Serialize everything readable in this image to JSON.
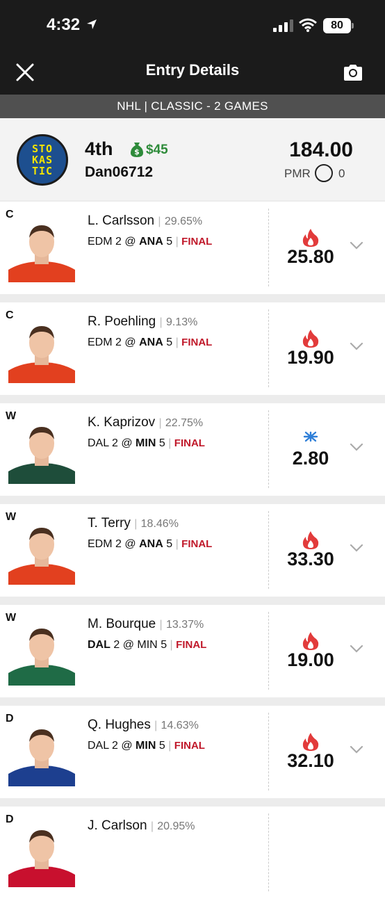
{
  "status_bar": {
    "time": "4:32",
    "battery": "80"
  },
  "header": {
    "title": "Entry Details"
  },
  "contest": {
    "label": "NHL | CLASSIC - 2 GAMES"
  },
  "entry": {
    "logo_lines": [
      "STO",
      "KAS",
      "TIC"
    ],
    "rank": "4th",
    "prize": "$45",
    "username": "Dan06712",
    "score": "184.00",
    "pmr_label": "PMR",
    "pmr_value": "0"
  },
  "players": [
    {
      "pos": "C",
      "name": "L. Carlsson",
      "own": "29.65%",
      "away": "EDM",
      "away_score": "2",
      "at": "@",
      "home": "ANA",
      "home_score": "5",
      "bold_team": "home",
      "status": "FINAL",
      "trend": "fire",
      "fpts": "25.80",
      "jersey": "#e2401f"
    },
    {
      "pos": "C",
      "name": "R. Poehling",
      "own": "9.13%",
      "away": "EDM",
      "away_score": "2",
      "at": "@",
      "home": "ANA",
      "home_score": "5",
      "bold_team": "home",
      "status": "FINAL",
      "trend": "fire",
      "fpts": "19.90",
      "jersey": "#e2401f"
    },
    {
      "pos": "W",
      "name": "K. Kaprizov",
      "own": "22.75%",
      "away": "DAL",
      "away_score": "2",
      "at": "@",
      "home": "MIN",
      "home_score": "5",
      "bold_team": "home",
      "status": "FINAL",
      "trend": "ice",
      "fpts": "2.80",
      "jersey": "#1e4d3a"
    },
    {
      "pos": "W",
      "name": "T. Terry",
      "own": "18.46%",
      "away": "EDM",
      "away_score": "2",
      "at": "@",
      "home": "ANA",
      "home_score": "5",
      "bold_team": "home",
      "status": "FINAL",
      "trend": "fire",
      "fpts": "33.30",
      "jersey": "#e2401f"
    },
    {
      "pos": "W",
      "name": "M. Bourque",
      "own": "13.37%",
      "away": "DAL",
      "away_score": "2",
      "at": "@",
      "home": "MIN",
      "home_score": "5",
      "bold_team": "away",
      "status": "FINAL",
      "trend": "fire",
      "fpts": "19.00",
      "jersey": "#1f6b46"
    },
    {
      "pos": "D",
      "name": "Q. Hughes",
      "own": "14.63%",
      "away": "DAL",
      "away_score": "2",
      "at": "@",
      "home": "MIN",
      "home_score": "5",
      "bold_team": "home",
      "status": "FINAL",
      "trend": "fire",
      "fpts": "32.10",
      "jersey": "#1d3f8f"
    },
    {
      "pos": "D",
      "name": "J. Carlson",
      "own": "20.95%",
      "away": "",
      "away_score": "",
      "at": "",
      "home": "",
      "home_score": "",
      "bold_team": "home",
      "status": "",
      "trend": "",
      "fpts": "",
      "jersey": "#c8102e"
    }
  ],
  "colors": {
    "fire": "#e23b3b",
    "ice": "#2f7fd8",
    "final": "#c0182a",
    "prize": "#2e8b3a"
  }
}
